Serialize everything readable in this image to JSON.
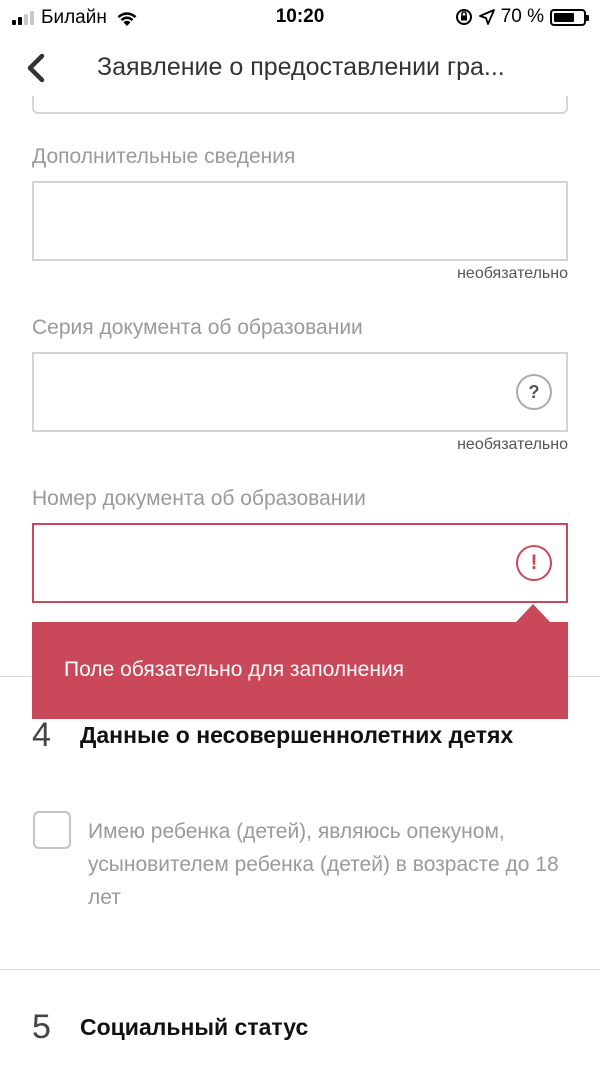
{
  "status_bar": {
    "carrier": "Билайн",
    "time": "10:20",
    "battery_percent_text": "70 %",
    "battery_level": 0.7,
    "signal_bars_on": 2,
    "signal_bars_total": 4
  },
  "nav": {
    "title": "Заявление о предоставлении гра...",
    "back_icon": "chevron-left-icon"
  },
  "fields": {
    "additional_info": {
      "label": "Дополнительные сведения",
      "value": "",
      "optional_text": "необязательно"
    },
    "doc_series": {
      "label": "Серия документа об образовании",
      "value": "",
      "help_icon": "?",
      "optional_text": "необязательно"
    },
    "doc_number": {
      "label": "Номер документа об образовании",
      "value": "",
      "error_icon": "!",
      "error_message": "Поле обязательно для заполнения"
    }
  },
  "sections": [
    {
      "number": "4",
      "title": "Данные о несовершеннолетних детях",
      "checkbox_label": "Имею ребенка (детей), являюсь опекуном, усыновителем ребенка (детей) в возрасте до 18 лет",
      "checkbox_checked": false
    },
    {
      "number": "5",
      "title": "Социальный статус"
    }
  ],
  "colors": {
    "error": "#c9495a",
    "border": "#d3d3d3",
    "label": "#9a9a9a"
  }
}
